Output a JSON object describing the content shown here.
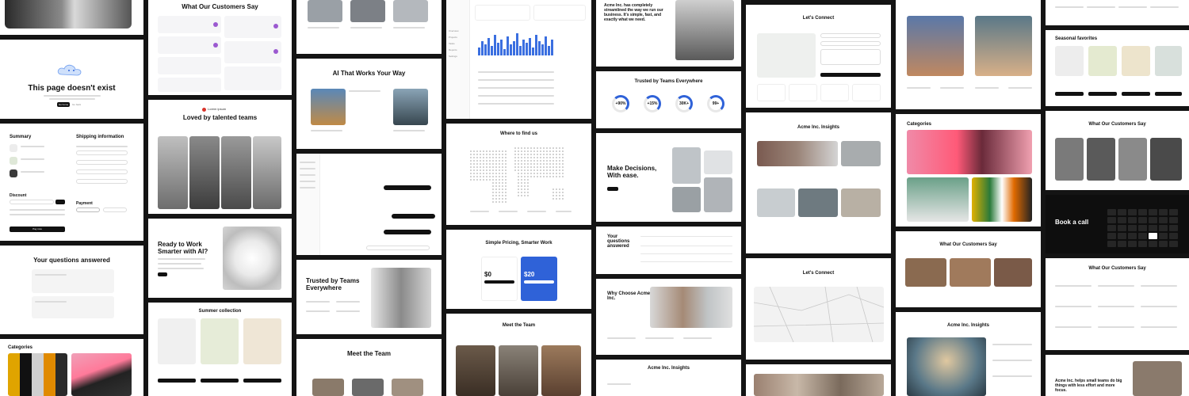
{
  "notfound": {
    "title": "This page doesn't exist",
    "primary": "Go home",
    "secondary": "Go back"
  },
  "testimonials": {
    "title": "What Our Customers Say"
  },
  "summary": {
    "title": "Summary",
    "shipping_title": "Shipping information",
    "discount": "Discount",
    "payment": "Payment",
    "button": "Pay now"
  },
  "loved": {
    "brand": "Lorem ipsum",
    "title": "Loved by talented teams"
  },
  "faq": {
    "title": "Your questions answered"
  },
  "ready": {
    "title": "Ready to Work Smarter with AI?"
  },
  "categories": {
    "title": "Categories"
  },
  "summer": {
    "title": "Summer collection"
  },
  "works": {
    "title": "AI That Works Your Way"
  },
  "trusted": {
    "title": "Trusted by Teams Everywhere"
  },
  "team": {
    "title": "Meet the Team"
  },
  "dashboard": {
    "items": [
      "Overview",
      "Projects",
      "Tasks",
      "Reports",
      "Settings"
    ]
  },
  "where": {
    "title": "Where to find us"
  },
  "pricing": {
    "title": "Simple Pricing, Smarter Work",
    "price_a": "$0",
    "price_b": "$20"
  },
  "quote": {
    "text": "Acme Inc. has completely streamlined the way we run our business. It's simple, fast, and exactly what we need."
  },
  "stats": {
    "title": "Trusted by Teams Everywhere",
    "rings": [
      "+90%",
      "+15%",
      "30K+",
      "99+"
    ]
  },
  "decisions": {
    "title": "Make Decisions, With ease."
  },
  "questions": {
    "title": "Your questions answered"
  },
  "why": {
    "title": "Why Choose Acme Inc."
  },
  "insights": {
    "title": "Acme Inc. Insights"
  },
  "connect": {
    "title": "Let's Connect"
  },
  "seasonal": {
    "title": "Seasonal favorites"
  },
  "booking": {
    "title": "Book a call"
  },
  "bottomhero": {
    "title": "Acme Inc. helps small teams do big things with less effort and more focus."
  },
  "colors": {
    "bg": "#141414",
    "accent": "#2f62d8",
    "dark": "#111111"
  }
}
